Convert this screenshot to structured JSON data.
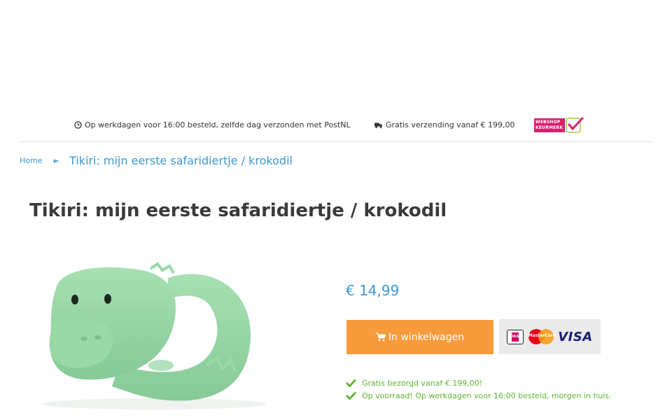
{
  "header": {
    "usps": [
      {
        "icon": "clock-icon",
        "text": "Op werkdagen voor 16:00 besteld, zelfde dag verzonden met PostNL"
      },
      {
        "icon": "truck-icon",
        "text": "Gratis verzending vanaf € 199,00"
      }
    ],
    "keurmerk": {
      "line1": "WEBSHOP",
      "line2": "KEURMERK"
    }
  },
  "breadcrumb": {
    "home": "Home",
    "separator": "►",
    "current": "Tikiri: mijn eerste safaridiertje / krokodil"
  },
  "product": {
    "title": "Tikiri: mijn eerste safaridiertje / krokodil",
    "price": "€ 14,99",
    "cart_label": "In winkelwagen",
    "payments": {
      "ideal": "iDEAL",
      "mastercard": "MasterCard",
      "visa": "VISA"
    },
    "usps": [
      "Gratis bezorgd vanaf € 199,00!",
      "Op voorraad! Op werkdagen voor 16:00 besteld, morgen in huis."
    ]
  },
  "colors": {
    "accent_blue": "#3c99d0",
    "cart_orange": "#f89b3c",
    "usp_green": "#5cb531",
    "product_green": "#98d8a6"
  }
}
